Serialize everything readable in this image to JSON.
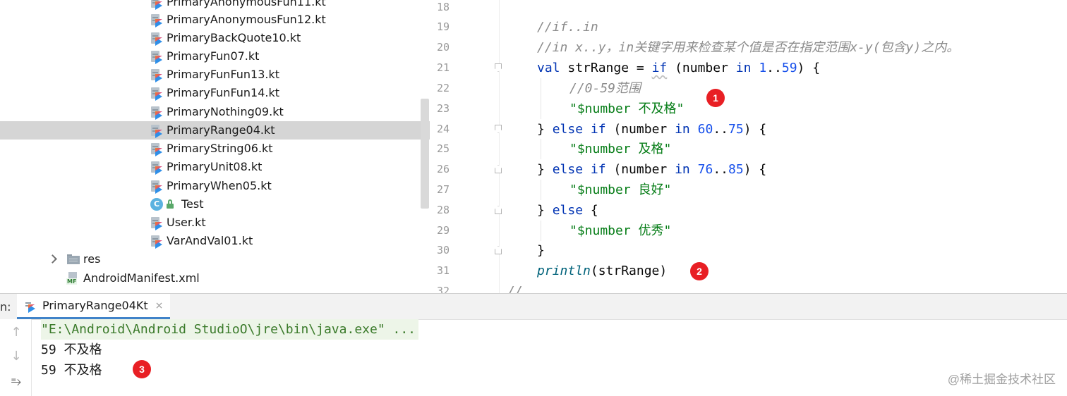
{
  "project_tree": {
    "items": [
      {
        "label": "PrimaryAnonymousFun11.kt"
      },
      {
        "label": "PrimaryAnonymousFun12.kt"
      },
      {
        "label": "PrimaryBackQuote10.kt"
      },
      {
        "label": "PrimaryFun07.kt"
      },
      {
        "label": "PrimaryFunFun13.kt"
      },
      {
        "label": "PrimaryFunFun14.kt"
      },
      {
        "label": "PrimaryNothing09.kt"
      },
      {
        "label": "PrimaryRange04.kt"
      },
      {
        "label": "PrimaryString06.kt"
      },
      {
        "label": "PrimaryUnit08.kt"
      },
      {
        "label": "PrimaryWhen05.kt"
      },
      {
        "label": "Test",
        "icon_letter": "C"
      },
      {
        "label": "User.kt"
      },
      {
        "label": "VarAndVal01.kt"
      },
      {
        "label": "res"
      },
      {
        "label": "AndroidManifest.xml",
        "icon_label": "MF"
      }
    ],
    "selected_label": "PrimaryRange04.kt"
  },
  "editor": {
    "line_numbers": [
      "18",
      "19",
      "20",
      "21",
      "22",
      "23",
      "24",
      "25",
      "26",
      "27",
      "28",
      "29",
      "30",
      "31",
      "32"
    ],
    "code": {
      "l19": "//if..in",
      "l20": "//in x..y，in关键字用来检查某个值是否在指定范围x-y(包含y)之内。",
      "l21": {
        "a": "val",
        "b": " strRange = ",
        "c": "if",
        "d": " (number ",
        "e": "in",
        "f": " ",
        "g": "1",
        "h": "..",
        "i": "59",
        "j": ") {"
      },
      "l22": "//0-59范围",
      "l23": "\"$number 不及格\"",
      "l24": {
        "a": "} ",
        "b": "else if",
        "c": " (number ",
        "d": "in",
        "e": " ",
        "f": "60",
        "g": "..",
        "h": "75",
        "i": ") {"
      },
      "l25": "\"$number 及格\"",
      "l26": {
        "a": "} ",
        "b": "else if",
        "c": " (number ",
        "d": "in",
        "e": " ",
        "f": "76",
        "g": "..",
        "h": "85",
        "i": ") {"
      },
      "l27": "\"$number 良好\"",
      "l28": {
        "a": "} ",
        "b": "else",
        "c": " {"
      },
      "l29": "\"$number 优秀\"",
      "l30": "}",
      "l31": {
        "a": "println",
        "b": "(strRange)"
      },
      "l32": "//"
    },
    "annotations": [
      "1",
      "2"
    ]
  },
  "run_panel": {
    "label": "n:",
    "tab_label": "PrimaryRange04Kt",
    "tab_close": "×",
    "console_lines": [
      "\"E:\\Android\\Android StudioO\\jre\\bin\\java.exe\" ...",
      "59 不及格",
      "59 不及格"
    ],
    "annotation": "3",
    "watermark": "@稀土掘金技术社区"
  },
  "colors": {
    "keyword": "#0033b3",
    "number": "#1750eb",
    "string": "#067d17",
    "comment": "#8c8c8c",
    "function": "#00627a",
    "selection": "#d5d5d5",
    "badge": "#e81f24"
  }
}
